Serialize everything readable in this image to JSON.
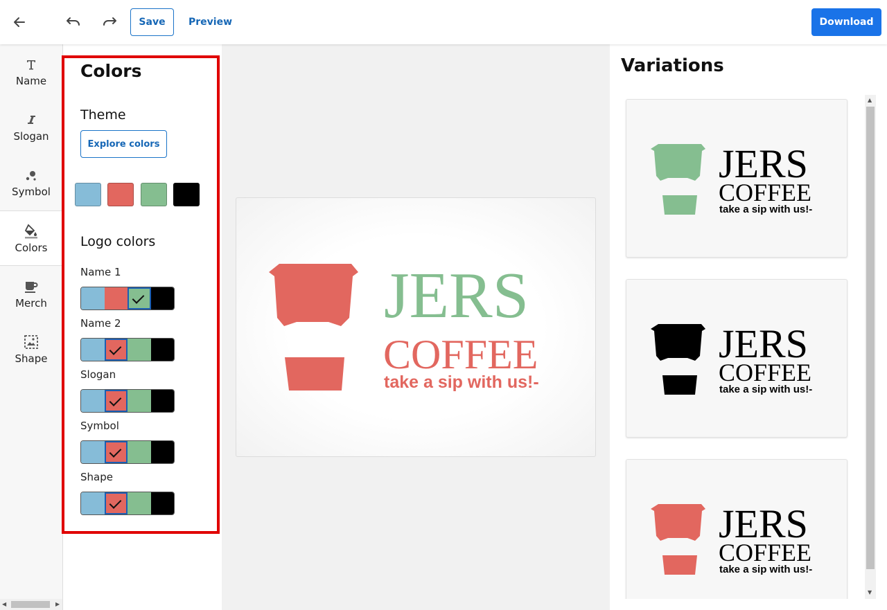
{
  "toolbar": {
    "back_icon": "arrow-left-icon",
    "undo_icon": "undo-icon",
    "redo_icon": "redo-icon",
    "save_label": "Save",
    "preview_label": "Preview",
    "download_label": "Download"
  },
  "sidebar": {
    "items": [
      {
        "label": "Name",
        "icon": "text-t-icon"
      },
      {
        "label": "Slogan",
        "icon": "italic-i-icon"
      },
      {
        "label": "Symbol",
        "icon": "bubbles-icon"
      },
      {
        "label": "Colors",
        "icon": "paint-bucket-icon",
        "active": true
      },
      {
        "label": "Merch",
        "icon": "mug-icon"
      },
      {
        "label": "Shape",
        "icon": "image-frame-icon"
      }
    ]
  },
  "panel": {
    "title": "Colors",
    "theme_heading": "Theme",
    "explore_label": "Explore colors",
    "theme_colors": [
      "#86bcd8",
      "#e2675f",
      "#85be90",
      "#000000"
    ],
    "logo_colors_heading": "Logo colors",
    "rows": [
      {
        "label": "Name 1",
        "selected": "#85be90"
      },
      {
        "label": "Name 2",
        "selected": "#e2675f"
      },
      {
        "label": "Slogan",
        "selected": "#e2675f"
      },
      {
        "label": "Symbol",
        "selected": "#e2675f"
      },
      {
        "label": "Shape",
        "selected": "#e2675f"
      }
    ]
  },
  "logo": {
    "name1": "JERS",
    "name2": "COFFEE",
    "slogan": "take a sip with us!-",
    "name1_color": "#85be90",
    "name2_color": "#e2675f",
    "slogan_color": "#e2675f",
    "symbol_color": "#e2675f"
  },
  "variations": {
    "title": "Variations",
    "cards": [
      {
        "symbol_color": "#85be90",
        "text_color": "#000000"
      },
      {
        "symbol_color": "#000000",
        "text_color": "#000000"
      },
      {
        "symbol_color": "#e2675f",
        "text_color": "#000000"
      }
    ]
  }
}
